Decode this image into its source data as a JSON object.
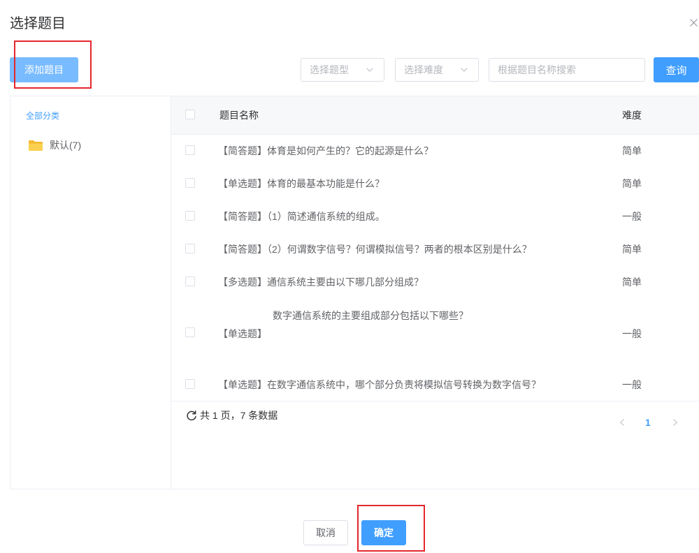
{
  "dialog": {
    "title": "选择题目",
    "close_icon": "close-icon"
  },
  "toolbar": {
    "add_question_label": "添加题目",
    "question_type_placeholder": "选择题型",
    "difficulty_placeholder": "选择难度",
    "dropdown_icon": "chevron-down-icon",
    "search_placeholder": "根据题目名称搜索",
    "search_value": "",
    "query_label": "查询"
  },
  "sidebar": {
    "all_categories_label": "全部分类",
    "folders": [
      {
        "label": "默认(7)",
        "icon": "folder-icon"
      }
    ]
  },
  "table": {
    "columns": {
      "name": "题目名称",
      "difficulty": "难度"
    },
    "select_all_checked": false,
    "rows": [
      {
        "type": "【简答题】",
        "title": "体育是如何产生的？它的起源是什么？",
        "difficulty": "简单",
        "checked": false
      },
      {
        "type": "【单选题】",
        "title": "体育的最基本功能是什么？",
        "difficulty": "简单",
        "checked": false
      },
      {
        "type": "【简答题】",
        "title": "（1）简述通信系统的组成。",
        "difficulty": "一般",
        "checked": false
      },
      {
        "type": "【简答题】",
        "title": "（2）何谓数字信号？何谓模拟信号？两者的根本区别是什么？",
        "difficulty": "简单",
        "checked": false
      },
      {
        "type": "【多选题】",
        "title": "通信系统主要由以下哪几部分组成？",
        "difficulty": "简单",
        "checked": false
      },
      {
        "type": "【单选题】",
        "title": "数字通信系统的主要组成部分包括以下哪些？",
        "difficulty": "一般",
        "checked": false
      },
      {
        "type": "【单选题】",
        "title": "在数字通信系统中，哪个部分负责将模拟信号转换为数字信号？",
        "difficulty": "一般",
        "checked": false
      }
    ]
  },
  "pagination": {
    "refresh_icon": "refresh-icon",
    "summary": "共 1 页，7 条数据",
    "current_page": "1",
    "prev_icon": "chevron-left-icon",
    "next_icon": "chevron-right-icon"
  },
  "actions": {
    "cancel_label": "取消",
    "confirm_label": "确定"
  },
  "colors": {
    "primary": "#409eff",
    "add_button": "#79bbff",
    "annotation": "#e4262c",
    "folder": "#f7c13f",
    "text": "#606266",
    "title": "#303133"
  }
}
